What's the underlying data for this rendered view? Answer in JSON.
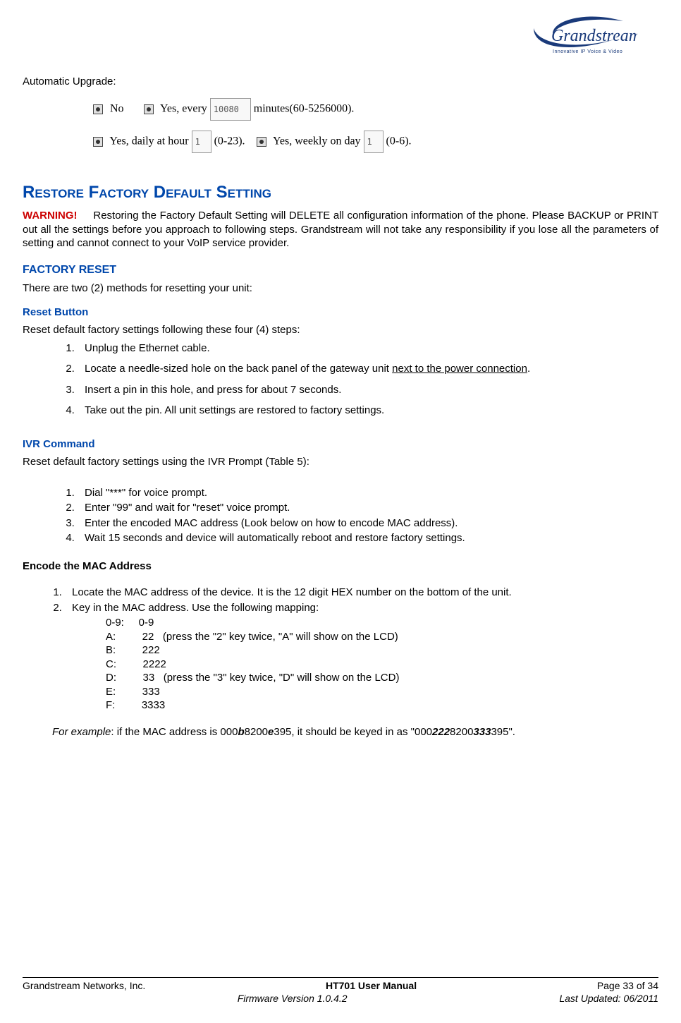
{
  "logo": {
    "brand": "Grandstream",
    "tagline": "Innovative IP Voice & Video"
  },
  "upgrade": {
    "label": "Automatic Upgrade:",
    "opt_no": "No",
    "opt_every_pre": "Yes, every",
    "opt_every_val": "10080",
    "opt_every_post": "minutes(60-5256000).",
    "opt_daily_pre": "Yes, daily at hour",
    "opt_daily_val": "1",
    "opt_daily_post": "(0-23).",
    "opt_weekly_pre": "Yes, weekly on day",
    "opt_weekly_val": "1",
    "opt_weekly_post": "(0-6)."
  },
  "restore": {
    "heading": "Restore Factory Default Setting",
    "warn_label": "WARNING!",
    "warn_text": "Restoring the Factory Default Setting will DELETE all configuration information of the phone. Please BACKUP or PRINT out all the settings before you approach to following steps. Grandstream will not take any responsibility if you lose all the parameters of setting and cannot connect to your VoIP service provider.",
    "factory_reset_h": "FACTORY RESET",
    "methods_intro": "There are two (2) methods for resetting your unit:",
    "reset_button_h": "Reset Button",
    "reset_button_intro": "Reset default factory settings following these four (4) steps:",
    "reset_steps": {
      "s1": "Unplug the Ethernet cable.",
      "s2a": "Locate a needle-sized hole on the back panel of the gateway unit ",
      "s2b": "next to the power connection",
      "s2c": ".",
      "s3": "Insert a pin in this hole, and press for about 7 seconds.",
      "s4": "Take out the pin.   All unit settings are restored to factory settings."
    },
    "ivr_h": "IVR Command",
    "ivr_intro": "Reset default factory settings using the IVR Prompt (Table 5):",
    "ivr_steps": {
      "s1": "Dial \"***\" for voice prompt.",
      "s2": "Enter \"99\" and wait for \"reset\" voice prompt.",
      "s3": "Enter the encoded MAC address (Look below on how to encode MAC address).",
      "s4": "Wait 15 seconds and device will automatically reboot and restore factory settings."
    },
    "encode_h": "Encode the MAC Address",
    "encode_steps": {
      "s1": "Locate the MAC address of the device.   It is the 12 digit HEX number on the bottom of the unit.",
      "s2": "Key in the MAC address.   Use the following mapping:"
    },
    "mapping": {
      "r0": "0-9:     0-9",
      "r1": "A:         22   (press the \"2\" key twice, \"A\" will show on the LCD)",
      "r2": "B:         222",
      "r3": "C:         2222",
      "r4": "D:         33   (press the \"3\" key twice, \"D\" will show on the LCD)",
      "r5": "E:         333",
      "r6": "F:         3333"
    },
    "example": {
      "label": "For example",
      "pre": ":   if the MAC address is 000",
      "b1": "b",
      "mid1": "8200",
      "e1": "e",
      "mid2": "395, it should be keyed in as \"000",
      "b2": "222",
      "mid3": "8200",
      "e2": "333",
      "post": "395\"."
    }
  },
  "footer": {
    "company": "Grandstream Networks, Inc.",
    "title": "HT701 User Manual",
    "page": "Page 33 of 34",
    "version": "Firmware Version 1.0.4.2",
    "updated": "Last Updated: 06/2011"
  }
}
